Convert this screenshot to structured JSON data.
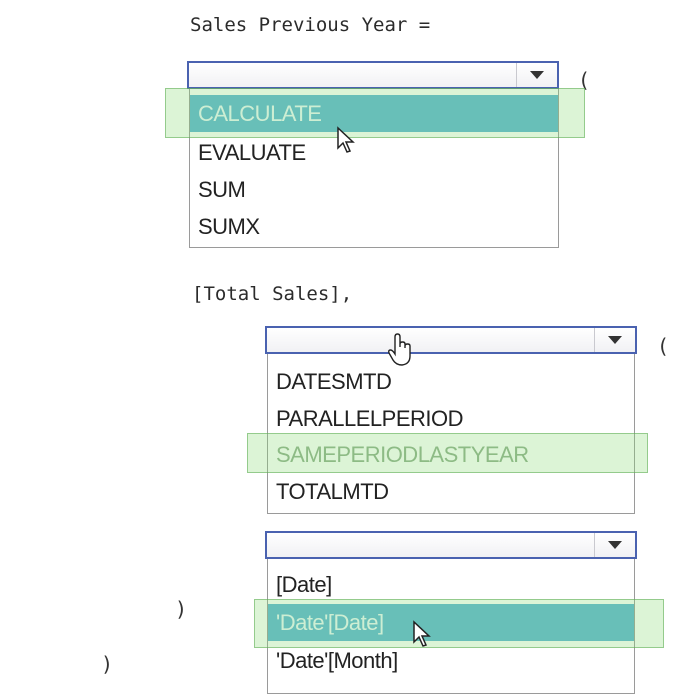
{
  "code": {
    "line1": "Sales Previous Year =",
    "line2": "[Total Sales],",
    "open_paren": "(",
    "close_paren": ")"
  },
  "dropdown1": {
    "options": [
      "CALCULATE",
      "EVALUATE",
      "SUM",
      "SUMX"
    ],
    "highlighted": "CALCULATE"
  },
  "dropdown2": {
    "options": [
      "DATESMTD",
      "PARALLELPERIOD",
      "SAMEPERIODLASTYEAR",
      "TOTALMTD"
    ],
    "highlighted": "SAMEPERIODLASTYEAR"
  },
  "dropdown3": {
    "options": [
      "[Date]",
      "'Date'[Date]",
      "'Date'[Month]"
    ],
    "highlighted": "'Date'[Date]"
  },
  "colors": {
    "selection_blue": "#5ab3d5",
    "answer_green": "#8cdc78",
    "dropdown_border": "#4a62b0"
  },
  "icons": [
    "chevron-down-icon",
    "arrow-cursor-icon",
    "hand-cursor-icon"
  ]
}
